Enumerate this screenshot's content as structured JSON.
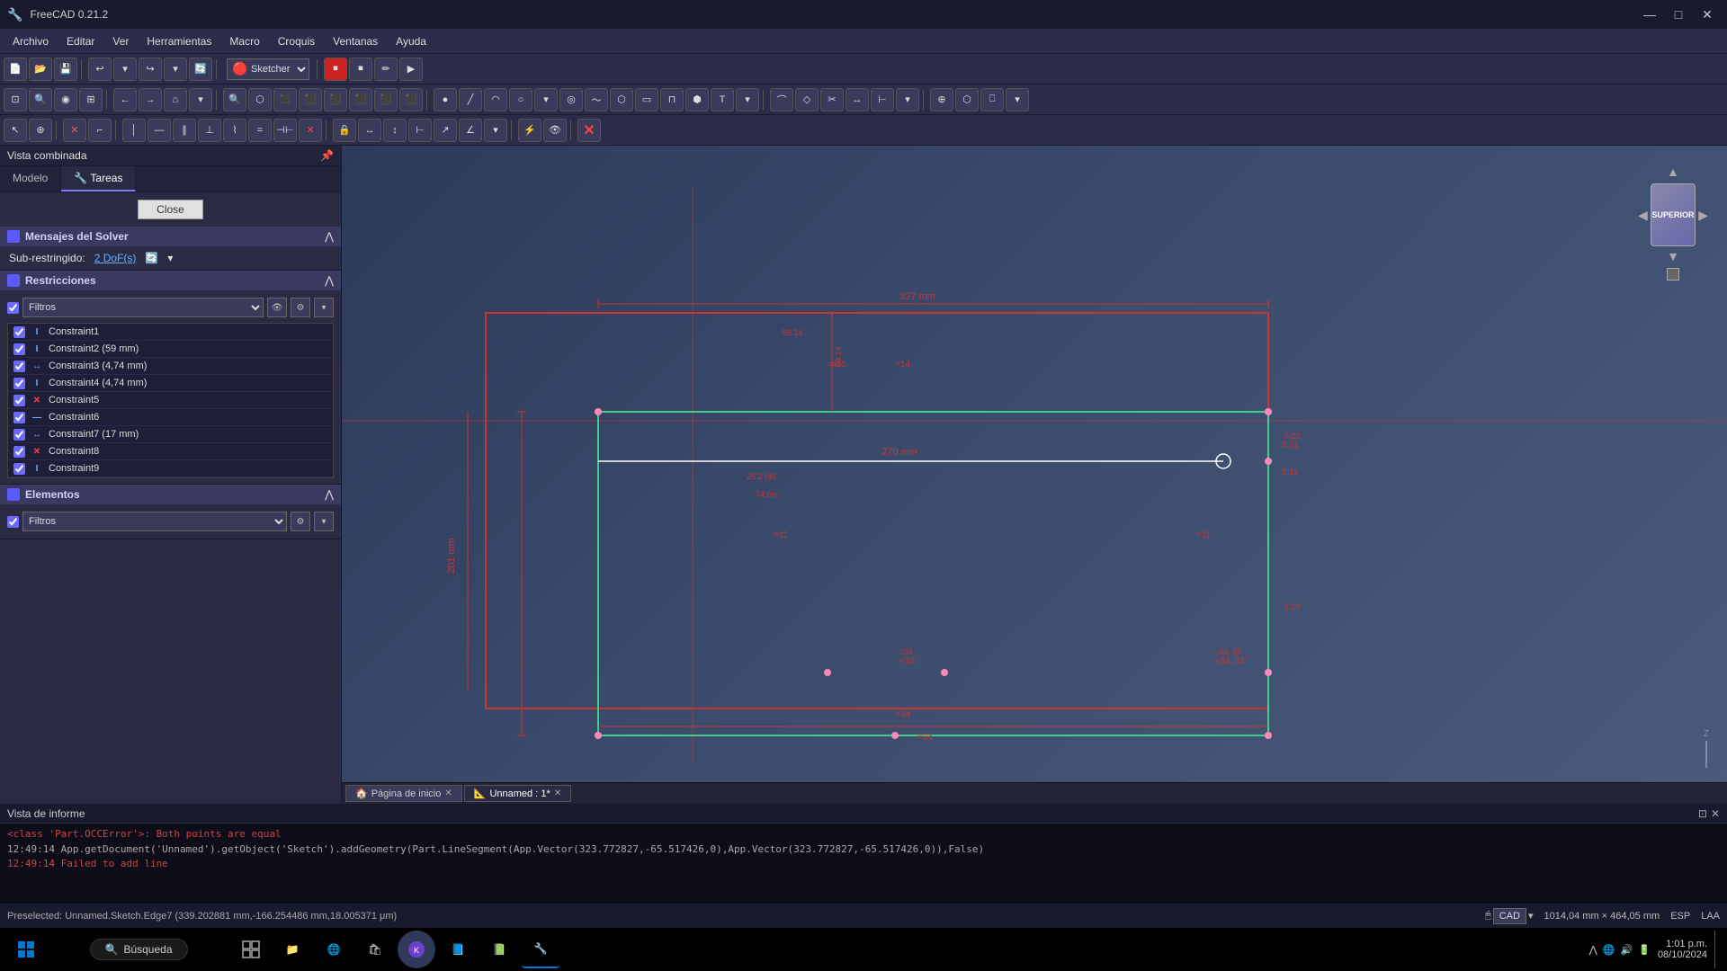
{
  "titlebar": {
    "title": "FreeCAD 0.21.2",
    "icon": "🔧",
    "min_label": "—",
    "max_label": "□",
    "close_label": "✕"
  },
  "menubar": {
    "items": [
      "Archivo",
      "Editar",
      "Ver",
      "Herramientas",
      "Macro",
      "Croquis",
      "Ventanas",
      "Ayuda"
    ]
  },
  "toolbar1": {
    "buttons": [
      "📄",
      "📂",
      "💾",
      "↩",
      "↪",
      "🔄",
      "▶",
      "⏸",
      "⏹",
      "▶"
    ]
  },
  "workbench_dropdown": "Sketcher",
  "sidebar": {
    "title": "Vista combinada",
    "tabs": [
      "Modelo",
      "Tareas"
    ],
    "active_tab": "Tareas",
    "close_btn": "Close",
    "solver_section": {
      "title": "Mensajes del Solver",
      "label_sub": "Sub-restringido:",
      "dof_value": "2 DoF(s)"
    },
    "restricciones_section": {
      "title": "Restricciones",
      "filter_placeholder": "Filtros",
      "constraints": [
        {
          "name": "Constraint1",
          "icon": "I",
          "type": "vertical"
        },
        {
          "name": "Constraint2 (59 mm)",
          "icon": "I",
          "type": "distance"
        },
        {
          "name": "Constraint3 (4,74 mm)",
          "icon": "↔",
          "type": "h-distance"
        },
        {
          "name": "Constraint4 (4,74 mm)",
          "icon": "I",
          "type": "v-distance"
        },
        {
          "name": "Constraint5",
          "icon": "✕",
          "type": "coincident"
        },
        {
          "name": "Constraint6",
          "icon": "—",
          "type": "horizontal"
        },
        {
          "name": "Constraint7 (17 mm)",
          "icon": "↔",
          "type": "h-distance"
        },
        {
          "name": "Constraint8",
          "icon": "✕",
          "type": "coincident"
        },
        {
          "name": "Constraint9",
          "icon": "I",
          "type": "vertical"
        }
      ]
    },
    "elementos_section": {
      "title": "Elementos",
      "filter_placeholder": "Filtros"
    }
  },
  "canvas": {
    "bg_color1": "#2d3a5a",
    "bg_color2": "#4a5a7a",
    "tabs": [
      {
        "label": "Página de inicio",
        "active": false,
        "closable": true
      },
      {
        "label": "Unnamed : 1*",
        "active": true,
        "closable": true
      }
    ],
    "nav_cube_label": "SUPERIOR"
  },
  "log": {
    "title": "Vista de informe",
    "lines": [
      {
        "text": "<class 'Part.OCCError'>: Both points are equal",
        "type": "info"
      },
      {
        "text": "12:49:14  App.getDocument('Unnamed').getObject('Sketch').addGeometry(Part.LineSegment(App.Vector(323.772827,-65.517426,0),App.Vector(323.772827,-65.517426,0)),False)",
        "type": "normal"
      },
      {
        "text": "12:49:14  Failed to add line",
        "type": "info"
      }
    ]
  },
  "statusbar": {
    "preselected_text": "Preselected: Unnamed.Sketch.Edge7 (339.202881 mm,-166.254486 mm,18.005371 μm)",
    "cad_label": "CAD",
    "dimensions": "1014,04 mm × 464,05 mm",
    "language": "ESP",
    "sublang": "LAA"
  },
  "taskbar": {
    "search_placeholder": "Búsqueda",
    "time": "1:01 p.m.",
    "date": "08/10/2024",
    "apps": [
      "🪟",
      "🔍",
      "🗂",
      "📁",
      "🌐",
      "🟤",
      "🔵",
      "🟣",
      "📘",
      "🟦",
      "🟢"
    ]
  }
}
